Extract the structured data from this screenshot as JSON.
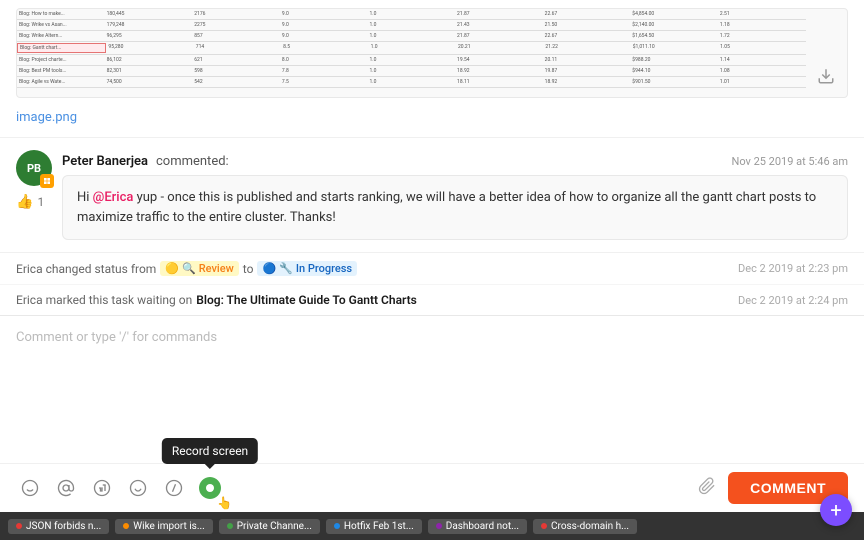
{
  "image": {
    "filename": "image.png",
    "alt": "Spreadsheet screenshot"
  },
  "comment": {
    "author": "Peter Banerjea",
    "avatar_initials": "PB",
    "avatar_bg": "#2e7d32",
    "action": "commented:",
    "timestamp": "Nov 25 2019 at 5:46 am",
    "mention": "@Erica",
    "body_text": " yup - once this is published and starts ranking, we will have a better idea of how to organize all the gantt chart posts to maximize traffic to the entire cluster. Thanks!",
    "likes": 1
  },
  "activity": [
    {
      "actor": "Erica",
      "action": "changed status from",
      "from_status": "Review",
      "to_word": "to",
      "to_status": "In Progress",
      "timestamp": "Dec 2 2019 at 2:23 pm"
    },
    {
      "actor": "Erica",
      "action": "marked this task waiting on",
      "task_name": "Blog: The Ultimate Guide To Gantt Charts",
      "timestamp": "Dec 2 2019 at 2:24 pm"
    }
  ],
  "comment_input": {
    "placeholder": "Comment or type '/' for commands"
  },
  "toolbar": {
    "icons": [
      {
        "name": "emoji-icon",
        "symbol": "🙂"
      },
      {
        "name": "mention-icon",
        "symbol": "@"
      },
      {
        "name": "gif-icon",
        "symbol": "😄"
      },
      {
        "name": "emoji2-icon",
        "symbol": "😊"
      },
      {
        "name": "slash-icon",
        "symbol": "/"
      },
      {
        "name": "record-icon",
        "symbol": ""
      }
    ],
    "record_tooltip": "Record screen",
    "comment_button": "COMMENT"
  },
  "taskbar": {
    "items": [
      {
        "label": "JSON forbids n...",
        "dot_color": "dot-red"
      },
      {
        "label": "Wike import is...",
        "dot_color": "dot-orange"
      },
      {
        "label": "Private Channe...",
        "dot_color": "dot-green"
      },
      {
        "label": "Hotfix Feb 1st...",
        "dot_color": "dot-blue"
      },
      {
        "label": "Dashboard not...",
        "dot_color": "dot-purple"
      },
      {
        "label": "Cross-domain h...",
        "dot_color": "dot-red"
      }
    ]
  },
  "fab": {
    "label": "+"
  }
}
